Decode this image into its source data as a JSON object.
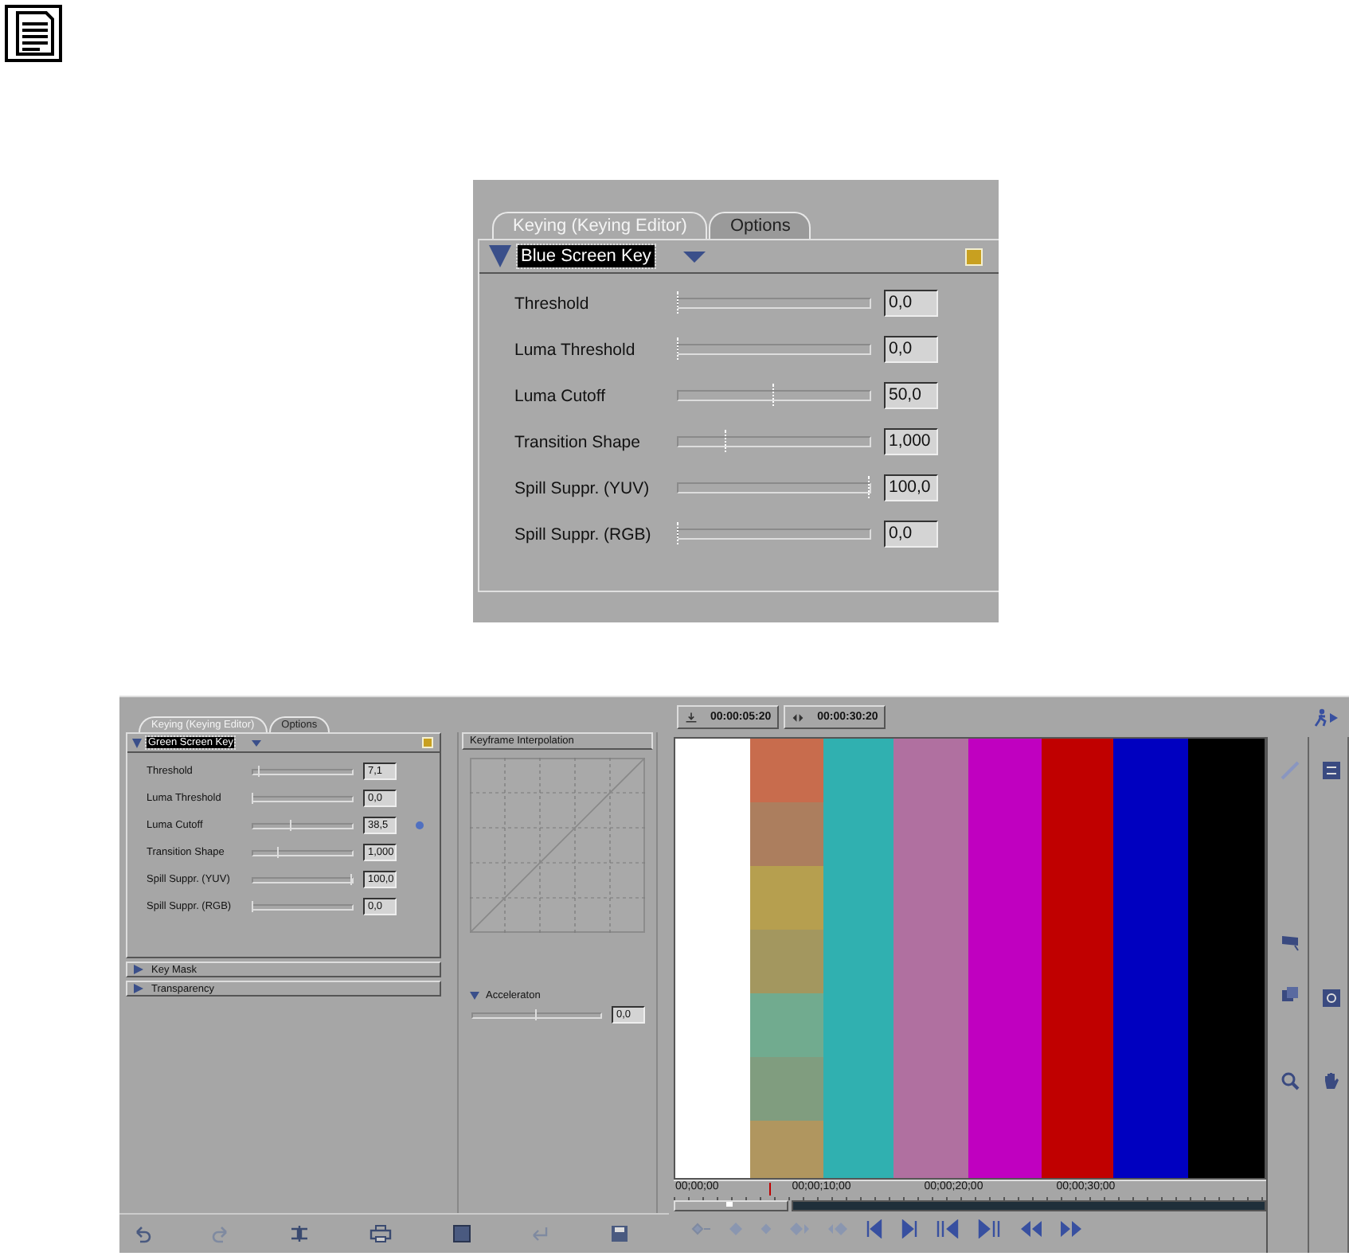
{
  "small_editor": {
    "tabs": [
      {
        "label": "Keying (Keying Editor)",
        "selected": true
      },
      {
        "label": "Options",
        "selected": false
      }
    ],
    "key_type": "Blue Screen Key",
    "params": [
      {
        "name": "Threshold",
        "level": 0,
        "value": "0,0",
        "keyframe": false
      },
      {
        "name": "Luma Threshold",
        "level": 0,
        "value": "0,0",
        "keyframe": false
      },
      {
        "name": "Luma Cutoff",
        "level": 0.5,
        "value": "50,0",
        "keyframe": false
      },
      {
        "name": "Transition Shape",
        "level": 0.25,
        "value": "1,000",
        "keyframe": false
      },
      {
        "name": "Spill Suppr. (YUV)",
        "level": 1,
        "value": "100,0",
        "keyframe": false
      },
      {
        "name": "Spill Suppr. (RGB)",
        "level": 0,
        "value": "0,0",
        "keyframe": false
      }
    ]
  },
  "full_editor": {
    "tabs": [
      {
        "label": "Keying (Keying Editor)",
        "selected": true
      },
      {
        "label": "Options",
        "selected": false
      }
    ],
    "key_type": "Green Screen Key",
    "params": [
      {
        "name": "Threshold",
        "level": 0.07,
        "value": "7,1",
        "keyframe": false
      },
      {
        "name": "Luma Threshold",
        "level": 0,
        "value": "0,0",
        "keyframe": false
      },
      {
        "name": "Luma Cutoff",
        "level": 0.385,
        "value": "38,5",
        "keyframe": true
      },
      {
        "name": "Transition Shape",
        "level": 0.25,
        "value": "1,000",
        "keyframe": false
      },
      {
        "name": "Spill Suppr. (YUV)",
        "level": 1,
        "value": "100,0",
        "keyframe": false
      },
      {
        "name": "Spill Suppr. (RGB)",
        "level": 0,
        "value": "0,0",
        "keyframe": false
      }
    ],
    "sections": [
      {
        "label": "Key Mask",
        "expanded": false
      },
      {
        "label": "Transparency",
        "expanded": false
      }
    ],
    "interpolation": {
      "title": "Keyframe Interpolation",
      "acceleration": {
        "label": "Acceleraton",
        "expanded": true,
        "level": 0.5,
        "value": "0,0"
      }
    },
    "timecodes": [
      "00:00:05:20",
      "00:00:30:20"
    ],
    "timeline": {
      "labels": [
        "00;00;00",
        "00;00;10;00",
        "00;00;20;00",
        "00;00;30;00"
      ],
      "playhead": {
        "level": 0.16
      },
      "zoom": {
        "level": 0.48
      }
    }
  }
}
